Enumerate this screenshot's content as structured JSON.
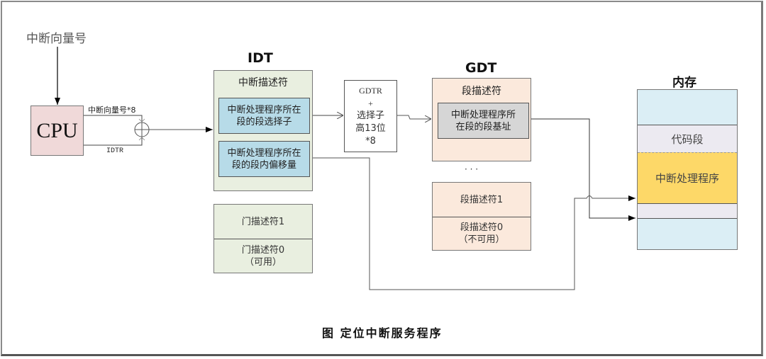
{
  "diagram": {
    "caption": "图 定位中断服务程序",
    "input_label": "中断向量号",
    "cpu": {
      "label": "CPU"
    },
    "adder": {
      "top_input_label": "中断向量号*8",
      "bottom_input_label": "IDTR",
      "symbol": "⊕"
    },
    "idt": {
      "title": "IDT",
      "descriptor_header": "中断描述符",
      "fields": [
        {
          "line1": "中断处理程序所在",
          "line2": "段的段选择子"
        },
        {
          "line1": "中断处理程序所在",
          "line2": "段的段内偏移量"
        }
      ],
      "gate_descriptors": [
        {
          "line1": "门描述符1",
          "line2": ""
        },
        {
          "line1": "门描述符0",
          "line2": "（可用）"
        }
      ]
    },
    "gdtr_calc": {
      "lines": [
        "GDTR",
        "+",
        "选择子",
        "高13位",
        "*8"
      ]
    },
    "gdt": {
      "title": "GDT",
      "descriptor_header": "段描述符",
      "field": {
        "line1": "中断处理程序所",
        "line2": "在段的段基址"
      },
      "ellipsis": "·  ·  ·",
      "segment_descriptors": [
        {
          "line1": "段描述符1",
          "line2": ""
        },
        {
          "line1": "段描述符0",
          "line2": "（不可用）"
        }
      ]
    },
    "memory": {
      "title": "内存",
      "code_segment_label": "代码段",
      "handler_label": "中断处理程序"
    },
    "colors": {
      "cpu_fill": "#f0d9d9",
      "idt_fill": "#e9efe0",
      "idt_field_fill": "#b7dbe8",
      "gdt_fill": "#fbe9dc",
      "gdt_field_fill": "#d6d6d6",
      "memory_fill": "#dbeef5",
      "code_segment_fill": "#eceaf1",
      "handler_fill": "#fdd868"
    }
  }
}
